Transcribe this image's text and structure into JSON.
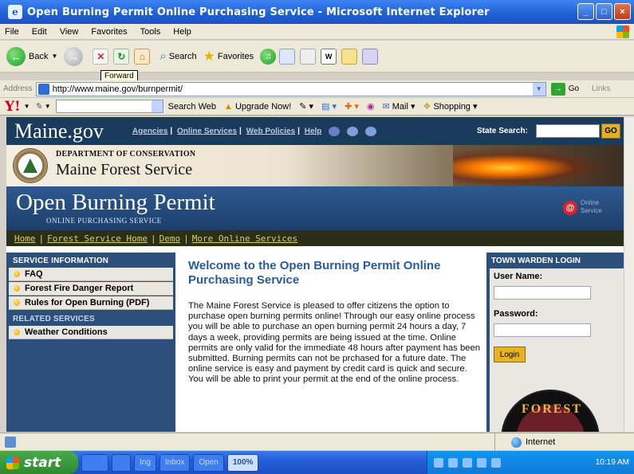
{
  "window": {
    "title": "Open Burning Permit Online Purchasing Service - Microsoft Internet Explorer",
    "min_glyph": "_",
    "max_glyph": "□",
    "close_glyph": "×"
  },
  "menubar": [
    "File",
    "Edit",
    "View",
    "Favorites",
    "Tools",
    "Help"
  ],
  "toolbar": {
    "back": "Back",
    "search": "Search",
    "favorites": "Favorites",
    "tooltip": "Forward"
  },
  "address": {
    "label": "Address",
    "url": "http://www.maine.gov/burnpermit/",
    "go": "Go",
    "links": "Links"
  },
  "yahoo": {
    "logo": "Y!",
    "search_web": "Search Web",
    "upgrade": "Upgrade Now!",
    "mail": "Mail",
    "shopping": "Shopping"
  },
  "page": {
    "header": {
      "logo": "Maine.gov",
      "nav": [
        "Agencies",
        "Online Services",
        "Web Policies",
        "Help"
      ],
      "state_search_label": "State Search:",
      "go": "GO"
    },
    "agency": {
      "dept": "DEPARTMENT OF CONSERVATION",
      "name": "Maine Forest Service"
    },
    "banner": {
      "title": "Open Burning Permit",
      "subtitle": "ONLINE PURCHASING SERVICE",
      "online_service": "Online Service"
    },
    "subnav": [
      "Home",
      "Forest Service Home",
      "Demo",
      "More Online Services"
    ],
    "left": {
      "service_heading": "SERVICE INFORMATION",
      "service_links": [
        "FAQ",
        "Forest Fire Danger Report",
        "Rules for Open Burning (PDF)"
      ],
      "related_heading": "RELATED SERVICES",
      "related_links": [
        "Weather Conditions"
      ]
    },
    "main": {
      "heading": "Welcome to the Open Burning Permit Online Purchasing Service",
      "body": "The Maine Forest Service is pleased to offer citizens the option to purchase open burning permits online! Through our easy online process you will be able to purchase an open burning permit 24 hours a day, 7 days a week, providing permits are being issued at the time. Online permits are only valid for the immediate 48 hours after payment has been submitted. Burning permits can not be prchased for a future date. The online service is easy and payment by credit card is quick and secure. You will be able to print your permit at the end of the online process."
    },
    "right": {
      "heading": "TOWN WARDEN LOGIN",
      "username_label": "User Name:",
      "password_label": "Password:",
      "login": "Login",
      "badge_text": "FOREST"
    }
  },
  "status": {
    "zone": "Internet"
  },
  "taskbar": {
    "start": "start",
    "items": [
      "Ing",
      "Inbox",
      "Open"
    ],
    "zoom": "100%",
    "clock": "10:19 AM"
  },
  "colors": {
    "page_header": "#1b3b5c",
    "banner": "#2d5a8e",
    "sidebar": "#2c4f7c",
    "heading_blue": "#2a5a9e",
    "subnav_text": "#d8cf6d",
    "login_button": "#e7b324"
  }
}
